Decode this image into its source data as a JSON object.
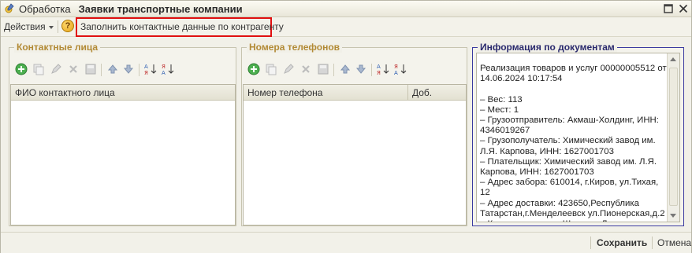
{
  "window": {
    "title_app": "Обработка",
    "title_doc": "Заявки транспортные компании",
    "icons": {
      "app": "processing-icon",
      "maximize": "maximize-icon",
      "close": "close-icon"
    }
  },
  "toolbar": {
    "actions_label": "Действия",
    "help_label": "?",
    "fill_contact_label": "Заполнить контактные данные по контрагенту"
  },
  "contacts": {
    "title": "Контактные лица",
    "column": "ФИО контактного лица",
    "icons": [
      "add-icon",
      "copy-icon",
      "edit-icon",
      "delete-icon",
      "save-icon",
      "move-up-icon",
      "move-down-icon",
      "sort-asc-icon",
      "sort-desc-icon"
    ]
  },
  "phones": {
    "title": "Номера телефонов",
    "column_phone": "Номер телефона",
    "column_ext": "Доб.",
    "icons": [
      "add-icon",
      "copy-icon",
      "edit-icon",
      "delete-icon",
      "save-icon",
      "move-up-icon",
      "move-down-icon",
      "sort-asc-icon",
      "sort-desc-icon"
    ]
  },
  "info": {
    "title": "Информация по документам",
    "text": "Реализация товаров и услуг 00000005512 от\n14.06.2024 10:17:54\n\n– Вес: 113\n– Мест: 1\n– Грузоотправитель: Акмаш-Холдинг, ИНН:\n4346019267\n– Грузополучатель: Химический завод им.\nЛ.Я. Карпова, ИНН: 1627001703\n– Плательщик: Химический завод им. Л.Я.\nКарпова, ИНН: 1627001703\n– Адрес забора: 610014, г.Киров, ул.Тихая, 12\n– Адрес доставки: 423650,Республика\nТатарстан,г.Менделеевск ул.Пионерская,д.2\n– Контактное лицо: Шестова Лилия\nМ"
  },
  "footer": {
    "save_label": "Сохранить",
    "cancel_label": "Отмена"
  },
  "colors": {
    "highlight_border": "#e01010",
    "group_title": "#b28a35",
    "info_border": "#3a3aa0"
  }
}
